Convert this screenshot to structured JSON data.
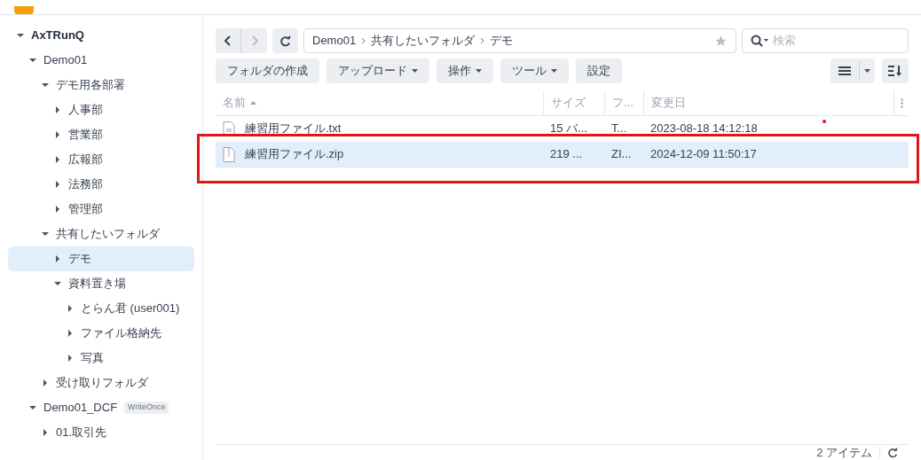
{
  "tree": [
    {
      "label": "AxTRunQ",
      "expanded": true,
      "selected": false,
      "children": [
        {
          "label": "Demo01",
          "expanded": true,
          "selected": false,
          "children": [
            {
              "label": "デモ用各部署",
              "expanded": true,
              "selected": false,
              "children": [
                {
                  "label": "人事部",
                  "expanded": false,
                  "selected": false
                },
                {
                  "label": "営業部",
                  "expanded": false,
                  "selected": false
                },
                {
                  "label": "広報部",
                  "expanded": false,
                  "selected": false
                },
                {
                  "label": "法務部",
                  "expanded": false,
                  "selected": false
                },
                {
                  "label": "管理部",
                  "expanded": false,
                  "selected": false
                }
              ]
            },
            {
              "label": "共有したいフォルダ",
              "expanded": true,
              "selected": false,
              "children": [
                {
                  "label": "デモ",
                  "expanded": false,
                  "selected": true
                },
                {
                  "label": "資料置き場",
                  "expanded": true,
                  "selected": false,
                  "children": [
                    {
                      "label": "とらん君 (user001)",
                      "expanded": false,
                      "selected": false
                    },
                    {
                      "label": "ファイル格納先",
                      "expanded": false,
                      "selected": false
                    },
                    {
                      "label": "写真",
                      "expanded": false,
                      "selected": false
                    }
                  ]
                }
              ]
            },
            {
              "label": "受け取りフォルダ",
              "expanded": false,
              "selected": false
            }
          ]
        },
        {
          "label": "Demo01_DCF",
          "badge": "WriteOnce",
          "expanded": true,
          "selected": false,
          "children": [
            {
              "label": "01.取引先",
              "expanded": false,
              "selected": false
            }
          ]
        }
      ]
    }
  ],
  "path": [
    "Demo01",
    "共有したいフォルダ",
    "デモ"
  ],
  "search": {
    "placeholder": "検索"
  },
  "toolbar": [
    {
      "label": "フォルダの作成",
      "menu": false
    },
    {
      "label": "アップロード",
      "menu": true
    },
    {
      "label": "操作",
      "menu": true
    },
    {
      "label": "ツール",
      "menu": true
    },
    {
      "label": "設定",
      "menu": false
    }
  ],
  "table": {
    "columns": [
      {
        "label": "名前",
        "sorted": true
      },
      {
        "label": "サイズ",
        "sorted": false
      },
      {
        "label": "フ...",
        "sorted": false
      },
      {
        "label": "変更日",
        "sorted": false
      }
    ],
    "rows": [
      {
        "kind": "text",
        "name": "練習用ファイル.txt",
        "size": "15 バ...",
        "type": "T...",
        "modified": "2023-08-18 14:12:18",
        "selected": false
      },
      {
        "kind": "archive",
        "name": "練習用ファイル.zip",
        "size": "219 ...",
        "type": "ZI...",
        "modified": "2024-12-09 11:50:17",
        "selected": true
      }
    ]
  },
  "status_bar": {
    "count": "2 アイテム"
  }
}
